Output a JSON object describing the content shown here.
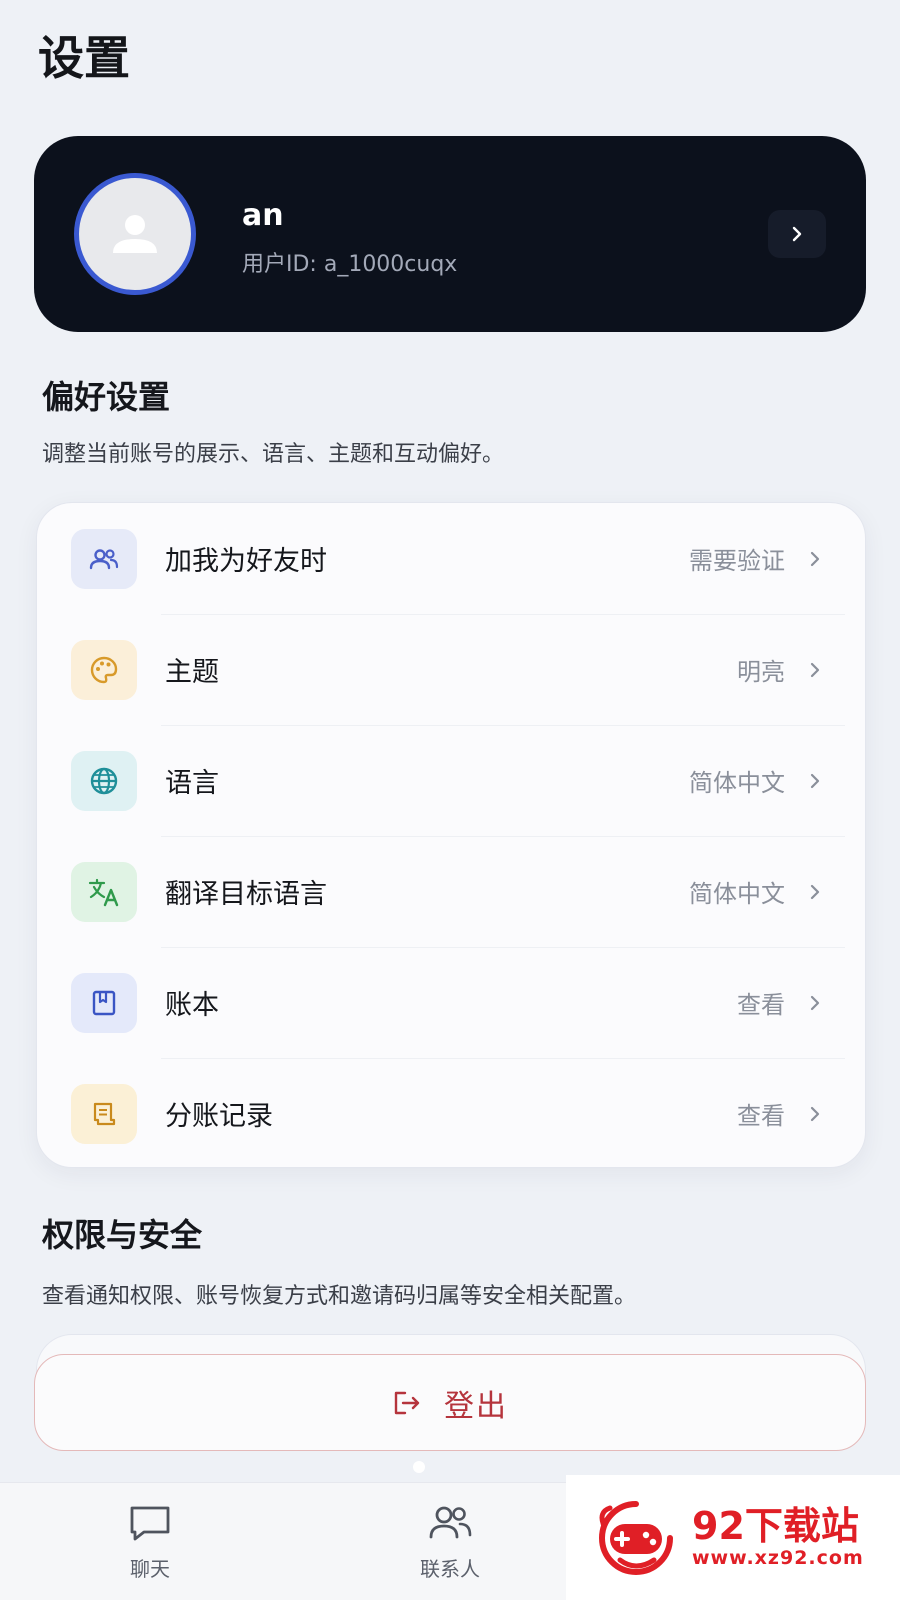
{
  "page_title": "设置",
  "profile": {
    "name": "an",
    "user_id": "用户ID: a_1000cuqx"
  },
  "preferences": {
    "title": "偏好设置",
    "description": "调整当前账号的展示、语言、主题和互动偏好。",
    "items": [
      {
        "label": "加我为好友时",
        "value": "需要验证",
        "icon": "contacts-icon"
      },
      {
        "label": "主题",
        "value": "明亮",
        "icon": "palette-icon"
      },
      {
        "label": "语言",
        "value": "简体中文",
        "icon": "globe-icon"
      },
      {
        "label": "翻译目标语言",
        "value": "简体中文",
        "icon": "translate-icon"
      },
      {
        "label": "账本",
        "value": "查看",
        "icon": "ledger-icon"
      },
      {
        "label": "分账记录",
        "value": "查看",
        "icon": "receipt-icon"
      }
    ]
  },
  "security": {
    "title": "权限与安全",
    "description": "查看通知权限、账号恢复方式和邀请码归属等安全相关配置。"
  },
  "logout_label": "登出",
  "bottom_nav": [
    {
      "label": "聊天",
      "icon": "chat-icon"
    },
    {
      "label": "联系人",
      "icon": "contacts-icon"
    }
  ],
  "watermark": {
    "title": "92下载站",
    "url": "www.xz92.com"
  },
  "colors": {
    "background": "#eef1f6",
    "profile_card": "#0c111c",
    "avatar_ring": "#3a59d1",
    "logout_red": "#b5343c",
    "watermark_red": "#e01f26"
  }
}
